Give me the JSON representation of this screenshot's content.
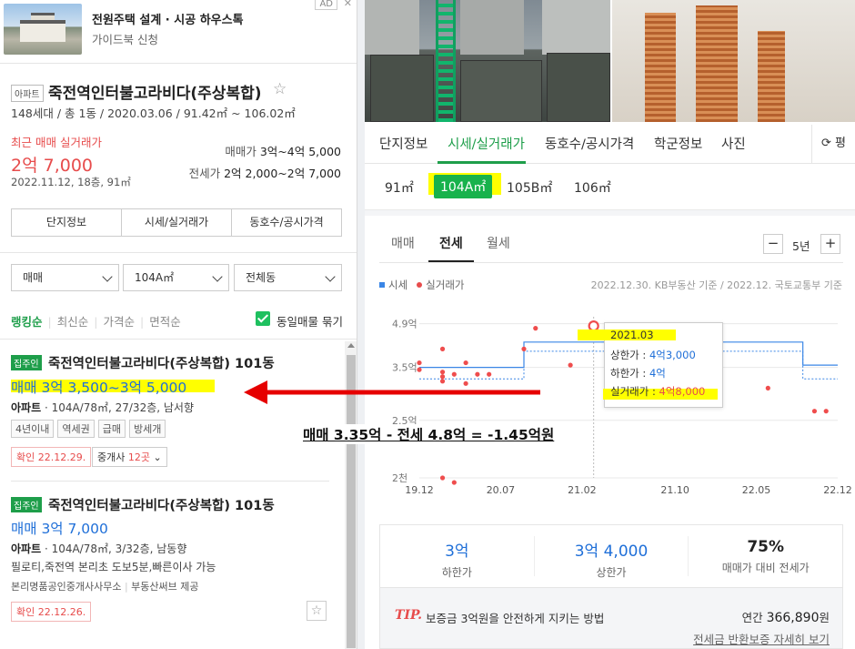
{
  "ad": {
    "title": "전원주택 설계 · 시공 하우스톡",
    "subtitle": "가이드북 신청",
    "badge": "AD",
    "close": "✕"
  },
  "complex": {
    "type": "아파트",
    "name": "죽전역인터불고라비다(주상복합)",
    "info": "148세대 / 총 1동 / 2020.03.06 / 91.42㎡ ~ 106.02㎡",
    "recent_label": "최근 매매 실거래가",
    "recent_price": "2억 7,000",
    "recent_date": "2022.11.12, 18층, 91㎡",
    "sale_range_label": "매매가",
    "sale_range": "3억~4억 5,000",
    "jeonse_range_label": "전세가",
    "jeonse_range": "2억 2,000~2억 7,000",
    "buttons": [
      "단지정보",
      "시세/실거래가",
      "동호수/공시가격"
    ]
  },
  "filters": {
    "deal": "매매",
    "area": "104A㎡",
    "dong": "전체동"
  },
  "sort": {
    "options": [
      "랭킹순",
      "최신순",
      "가격순",
      "면적순"
    ],
    "group_label": "동일매물 묶기"
  },
  "listings": [
    {
      "tag": "집주인",
      "title": "죽전역인터불고라비다(주상복합) 101동",
      "price": "매매 3억 3,500~3억 5,000",
      "desc_type": "아파트",
      "desc": " · 104A/78㎡, 27/32층, 남서향",
      "features": [
        "4년이내",
        "역세권",
        "급매",
        "방세개"
      ],
      "confirm": "확인 22.12.29.",
      "broker_label": "중개사",
      "broker_count": "12곳"
    },
    {
      "tag": "집주인",
      "title": "죽전역인터불고라비다(주상복합) 101동",
      "price": "매매 3억 7,000",
      "desc_type": "아파트",
      "desc": " · 104A/78㎡, 3/32층, 남동향",
      "desc2": "필로티,죽전역 본리초 도보5분,빠른이사 가능",
      "agent": "본리명품공인중개사사무소",
      "agent_source": "부동산써브 제공",
      "confirm": "확인 22.12.26."
    }
  ],
  "right": {
    "tabs": [
      "단지정보",
      "시세/실거래가",
      "동호수/공시가격",
      "학군정보",
      "사진"
    ],
    "share": "평",
    "areas": [
      "91㎡",
      "104A㎡",
      "105B㎡",
      "106㎡"
    ],
    "subtabs": [
      "매매",
      "전세",
      "월세"
    ],
    "period": "5년",
    "minus": "−",
    "plus": "+",
    "legend_market": "시세",
    "legend_real": "실거래가",
    "source": "2022.12.30. KB부동산 기준 / 2022.12. 국토교통부 기준",
    "tooltip": {
      "date": "2021.03",
      "upper_label": "상한가 : ",
      "upper": "4억3,000",
      "lower_label": "하한가 : ",
      "lower": "4억",
      "real_label": "실거래가 : ",
      "real": "4억8,000"
    },
    "stats": [
      {
        "value": "3억",
        "label": "하한가"
      },
      {
        "value": "3억 4,000",
        "label": "상한가"
      },
      {
        "value": "75%",
        "label": "매매가 대비 전세가"
      }
    ],
    "tip_word": "TIP.",
    "tip_text": "보증금 3억원을 안전하게 지키는 방법",
    "tip_amount_label": "연간 ",
    "tip_amount": "366,890",
    "tip_amount_unit": "원",
    "tip_link": "전세금 반환보증 자세히 보기"
  },
  "annotation": {
    "formula": "매매 3.35억 - 전세 4.8억 = -1.45억원",
    "highlight_color": "#ffff00",
    "arrow_color": "#e60000"
  },
  "chart_data": {
    "type": "line",
    "title": "",
    "xlabel": "",
    "ylabel": "",
    "x_ticks": [
      "19.12",
      "20.07",
      "21.02",
      "21.10",
      "22.05",
      "22.12"
    ],
    "y_ticks": [
      "4.9억",
      "3.5억",
      "2.5억",
      "2천"
    ],
    "series": [
      {
        "name": "시세",
        "kind": "step",
        "x": [
          "2019.12",
          "2020.06",
          "2020.09",
          "2021.02",
          "2021.10",
          "2022.06",
          "2022.09",
          "2022.12"
        ],
        "upper": [
          3.9,
          3.9,
          4.45,
          4.45,
          4.45,
          4.45,
          3.95,
          3.95
        ],
        "lower": [
          3.65,
          3.65,
          4.25,
          4.25,
          4.25,
          4.25,
          3.65,
          3.65
        ]
      },
      {
        "name": "실거래가",
        "kind": "scatter",
        "points": [
          [
            "2019.12",
            4.0
          ],
          [
            "2019.12",
            3.85
          ],
          [
            "2020.02",
            4.3
          ],
          [
            "2020.02",
            3.8
          ],
          [
            "2020.02",
            3.7
          ],
          [
            "2020.02",
            3.6
          ],
          [
            "2020.03",
            3.75
          ],
          [
            "2020.04",
            4.0
          ],
          [
            "2020.04",
            3.55
          ],
          [
            "2020.05",
            3.75
          ],
          [
            "2020.06",
            3.75
          ],
          [
            "2020.09",
            4.3
          ],
          [
            "2020.10",
            4.75
          ],
          [
            "2021.01",
            3.95
          ],
          [
            "2021.03",
            4.8
          ],
          [
            "2021.07",
            4.8
          ],
          [
            "2021.08",
            4.6
          ],
          [
            "2021.11",
            4.3
          ],
          [
            "2022.01",
            4.3
          ],
          [
            "2022.01",
            4.0
          ],
          [
            "2022.06",
            3.45
          ],
          [
            "2022.10",
            2.95
          ],
          [
            "2022.11",
            2.95
          ],
          [
            "2020.02",
            1.5
          ],
          [
            "2020.03",
            1.4
          ]
        ]
      }
    ],
    "ylim": [
      1.5,
      5.0
    ],
    "grid": true,
    "legend": "top-left"
  }
}
